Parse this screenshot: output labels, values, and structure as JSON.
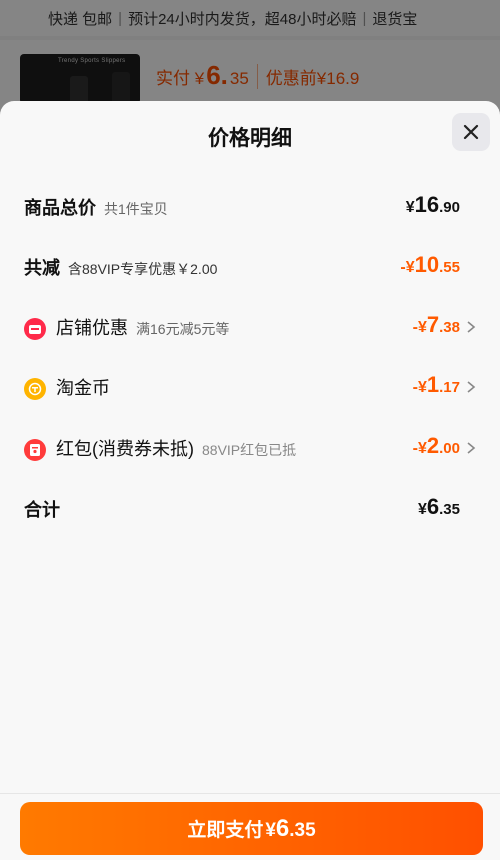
{
  "background": {
    "shipping": [
      "快递 包邮",
      "预计24小时内发货，超48小时必赔",
      "退货宝"
    ],
    "thumb_text": "Trendy Sports Slippers",
    "price_label": "实付 ¥",
    "price_int": "6.",
    "price_dec": "35",
    "original_price": "优惠前¥16.9"
  },
  "sheet": {
    "title": "价格明细",
    "close_icon": "close-icon"
  },
  "rows": {
    "total": {
      "label": "商品总价",
      "sub": "共1件宝贝",
      "cur": "¥",
      "int": "16",
      "dec": ".90"
    },
    "reduce": {
      "label": "共减",
      "sub": "含88VIP专享优惠￥2.00",
      "cur": "-¥",
      "int": "10",
      "dec": ".55"
    },
    "shop": {
      "label": "店铺优惠",
      "sub": "满16元减5元等",
      "cur": "-¥",
      "int": "7",
      "dec": ".38",
      "icon": "shop-icon"
    },
    "coin": {
      "label": "淘金币",
      "sub": "",
      "cur": "-¥",
      "int": "1",
      "dec": ".17",
      "icon": "coin-icon"
    },
    "redpack": {
      "label": "红包(消费券未抵)",
      "sub": "88VIP红包已抵",
      "cur": "-¥",
      "int": "2",
      "dec": ".00",
      "icon": "red-packet-icon"
    },
    "sum": {
      "label": "合计",
      "cur": "¥",
      "int": "6",
      "dec": ".35"
    }
  },
  "pay_button": {
    "label": "立即支付",
    "cur": "¥",
    "int": "6",
    "dec": ".35"
  },
  "colors": {
    "accent": "#ff5000",
    "orange_amount": "#ff5a00",
    "shop_icon": "#ff2a4a",
    "coin_icon": "#ffb400",
    "redpack_icon": "#ff3b3b"
  }
}
